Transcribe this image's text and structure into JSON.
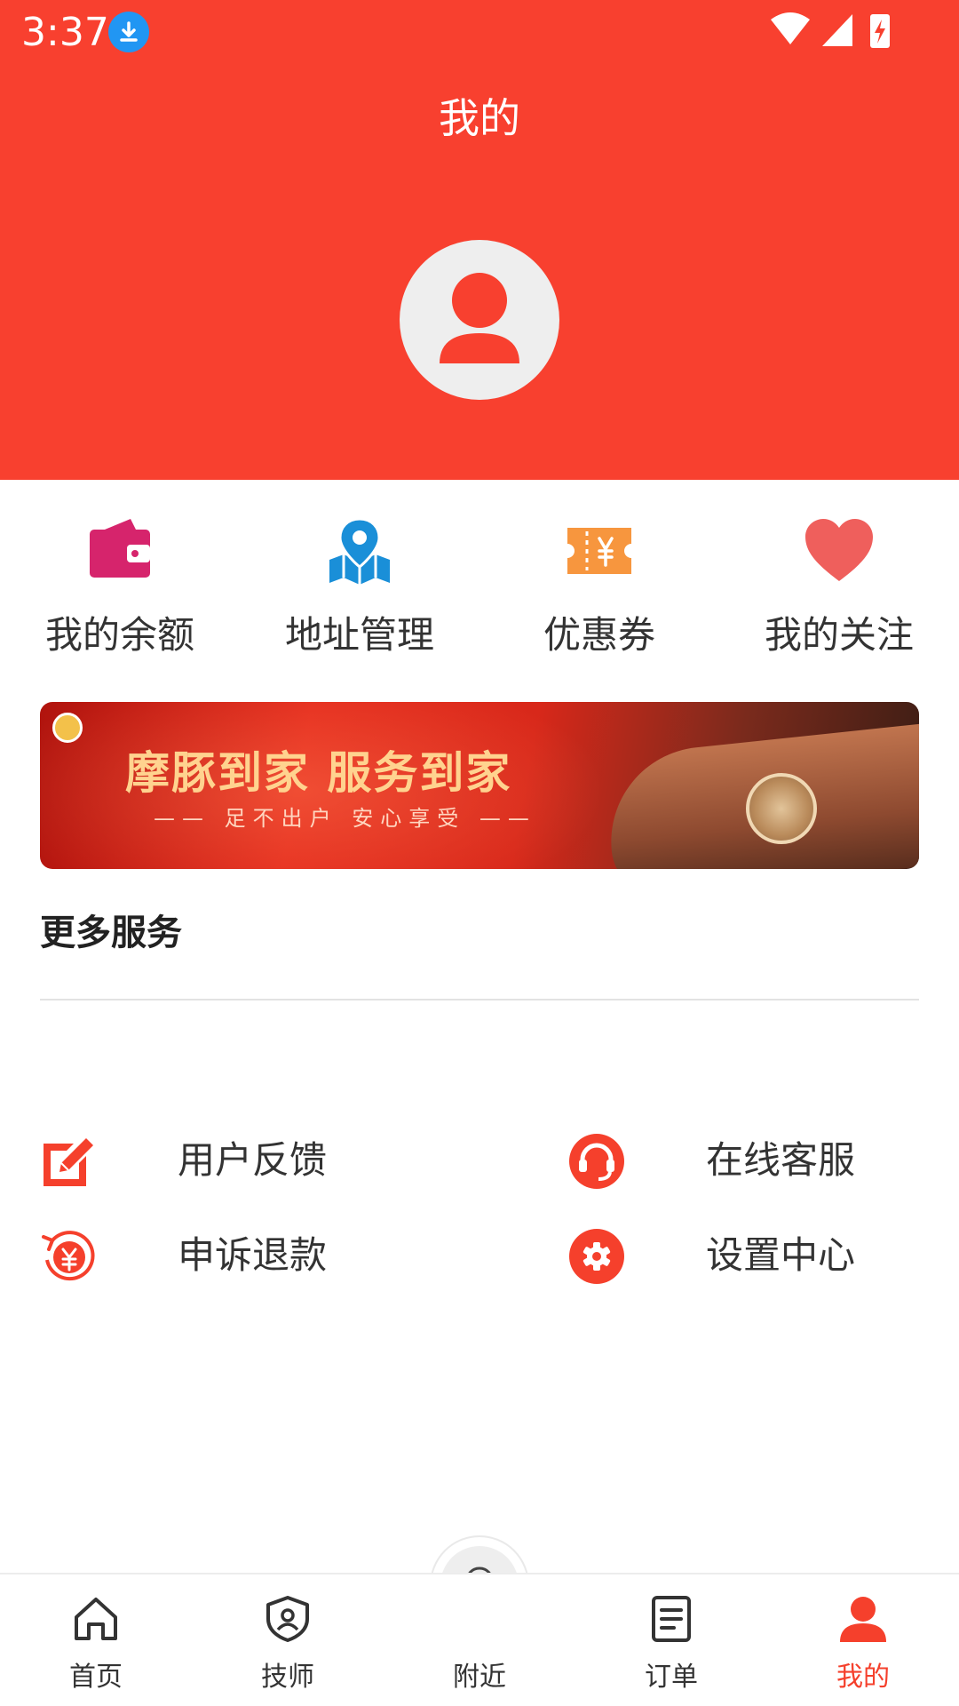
{
  "status_bar": {
    "time": "3:37"
  },
  "header": {
    "title": "我的"
  },
  "quick_actions": [
    {
      "label": "我的余额",
      "icon": "wallet-icon",
      "color": "#d6246c"
    },
    {
      "label": "地址管理",
      "icon": "map-pin-icon",
      "color": "#1a8fd8"
    },
    {
      "label": "优惠券",
      "icon": "coupon-icon",
      "color": "#f7963e"
    },
    {
      "label": "我的关注",
      "icon": "heart-icon",
      "color": "#ef5f5c"
    }
  ],
  "banner": {
    "headline": "摩豚到家 服务到家",
    "subtitle": "—— 足不出户 安心享受 ——"
  },
  "more_services": {
    "title": "更多服务",
    "items": [
      {
        "label": "用户反馈",
        "icon": "edit-icon"
      },
      {
        "label": "在线客服",
        "icon": "headset-icon"
      },
      {
        "label": "申诉退款",
        "icon": "refund-icon"
      },
      {
        "label": "设置中心",
        "icon": "settings-icon"
      }
    ]
  },
  "tabbar": {
    "items": [
      {
        "label": "首页",
        "icon": "home-icon"
      },
      {
        "label": "技师",
        "icon": "technician-icon"
      },
      {
        "label": "附近",
        "icon": "location-icon"
      },
      {
        "label": "订单",
        "icon": "order-icon"
      },
      {
        "label": "我的",
        "icon": "user-icon",
        "active": true
      }
    ]
  },
  "colors": {
    "primary": "#f8402f",
    "active_tab": "#f5402c"
  }
}
